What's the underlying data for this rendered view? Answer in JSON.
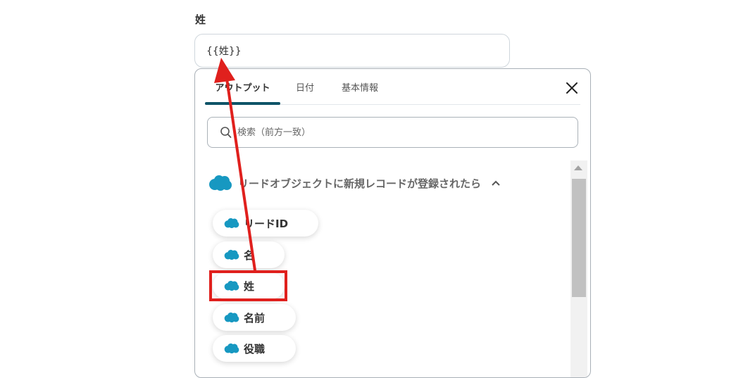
{
  "field": {
    "label": "姓",
    "value": "{{姓}}"
  },
  "tabs": [
    {
      "label": "アウトプット",
      "active": true
    },
    {
      "label": "日付",
      "active": false
    },
    {
      "label": "基本情報",
      "active": false
    }
  ],
  "search": {
    "placeholder": "検索（前方一致）"
  },
  "section": {
    "title": "リードオブジェクトに新規レコードが登録されたら",
    "icon": "salesforce-cloud-icon",
    "toggle_icon": "chevron-up-icon"
  },
  "items": [
    {
      "label": "リードID",
      "icon": "salesforce-cloud-icon"
    },
    {
      "label": "名",
      "icon": "salesforce-cloud-icon"
    },
    {
      "label": "姓",
      "icon": "salesforce-cloud-icon",
      "highlighted": true
    },
    {
      "label": "名前",
      "icon": "salesforce-cloud-icon"
    },
    {
      "label": "役職",
      "icon": "salesforce-cloud-icon"
    }
  ],
  "colors": {
    "accent": "#0f5468",
    "salesforce": "#1798c1",
    "annotation": "#e0201d"
  }
}
